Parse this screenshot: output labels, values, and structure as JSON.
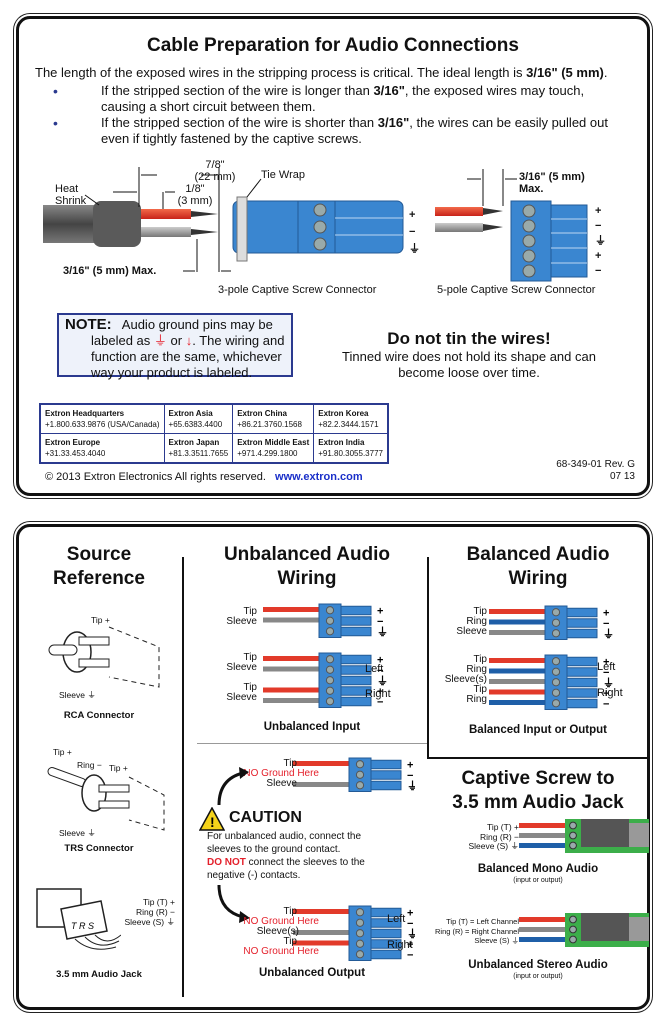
{
  "top_card": {
    "title": "Cable Preparation for Audio Connections",
    "intro_pre": "The length of the exposed wires in the stripping process is critical. The ideal length is ",
    "intro_bold": "3/16\" (5 mm)",
    "intro_post": ".",
    "bullets": [
      {
        "pre": "If the stripped section of the wire is longer than ",
        "bold": "3/16\"",
        "post": ", the exposed wires may touch, causing a short circuit between them."
      },
      {
        "pre": "If the stripped section of the wire is shorter than ",
        "bold": "3/16\"",
        "post": ", the wires can be easily pulled out even if tightly fastened by the captive screws."
      }
    ],
    "diagram3": {
      "dim_top_1": "7/8\"",
      "dim_top_2": "(22 mm)",
      "dim_mid_1": "1/8\"",
      "dim_mid_2": "(3 mm)",
      "heat_shrink_1": "Heat",
      "heat_shrink_2": "Shrink",
      "tie_wrap": "Tie Wrap",
      "max_label": "3/16\" (5 mm) Max.",
      "caption": "3-pole Captive Screw Connector",
      "pin_symbols": [
        "+",
        "−",
        "⏚"
      ]
    },
    "diagram5": {
      "max_label_1": "3/16\" (5 mm)",
      "max_label_2": "Max.",
      "caption": "5-pole Captive Screw Connector",
      "pin_symbols": [
        "+",
        "−",
        "⏚",
        "+",
        "−"
      ]
    },
    "note": {
      "label": "NOTE:",
      "line1": "Audio ground pins may be",
      "line2_pre": "labeled as ",
      "line2_sym1": "⏚",
      "line2_mid": " or ",
      "line2_sym2": "↓",
      "line2_post": ". The wiring and",
      "line3": "function are the same, whichever",
      "line4": "way your product is labeled."
    },
    "tin": {
      "title": "Do not tin the wires!",
      "line1": "Tinned wire does not hold its shape and can",
      "line2": "become loose over time."
    },
    "contacts": [
      [
        {
          "name": "Extron Headquarters",
          "phone": "+1.800.633.9876 (USA/Canada)"
        },
        {
          "name": "Extron Asia",
          "phone": "+65.6383.4400"
        },
        {
          "name": "Extron China",
          "phone": "+86.21.3760.1568"
        },
        {
          "name": "Extron Korea",
          "phone": "+82.2.3444.1571"
        }
      ],
      [
        {
          "name": "Extron Europe",
          "phone": "+31.33.453.4040"
        },
        {
          "name": "Extron Japan",
          "phone": "+81.3.3511.7655"
        },
        {
          "name": "Extron Middle East",
          "phone": "+971.4.299.1800"
        },
        {
          "name": "Extron India",
          "phone": "+91.80.3055.3777"
        }
      ]
    ],
    "doc_number": "68-349-01  Rev. G",
    "doc_date": "07 13",
    "copyright": "© 2013 Extron Electronics   All rights reserved.",
    "website": "www.extron.com"
  },
  "bottom_card": {
    "source_ref": {
      "title_1": "Source",
      "title_2": "Reference",
      "rca": {
        "tip": "Tip +",
        "sleeve": "Sleeve ⏚",
        "caption": "RCA Connector"
      },
      "trs": {
        "tip_left": "Tip +",
        "ring": "Ring −",
        "tip_right": "Tip +",
        "sleeve": "Sleeve ⏚",
        "caption": "TRS Connector"
      },
      "jack": {
        "tip": "Tip (T) +",
        "ring": "Ring (R) −",
        "sleeve": "Sleeve (S) ⏚",
        "letters": "T R S",
        "caption": "3.5 mm Audio Jack"
      }
    },
    "unbalanced": {
      "title_1": "Unbalanced Audio",
      "title_2": "Wiring",
      "input3": [
        "Tip",
        "Sleeve"
      ],
      "input5": [
        "Tip",
        "Sleeve",
        "Tip",
        "Sleeve"
      ],
      "left": "Left",
      "right": "Right",
      "input_caption": "Unbalanced Input",
      "out3": {
        "tip": "Tip",
        "no_ground": "NO Ground Here",
        "sleeve": "Sleeve"
      },
      "caution": {
        "title": "CAUTION",
        "line1": "For unbalanced audio, connect the",
        "line2": "sleeves to the ground contact.",
        "line3_red": "DO NOT",
        "line3_post": " connect the sleeves to the",
        "line4": "negative (-) contacts."
      },
      "out5": {
        "tip": "Tip",
        "no_ground": "NO Ground Here",
        "sleeves": "Sleeve(s)"
      },
      "output_caption": "Unbalanced Output"
    },
    "balanced": {
      "title_1": "Balanced Audio",
      "title_2": "Wiring",
      "three": [
        "Tip",
        "Ring",
        "Sleeve"
      ],
      "five": [
        "Tip",
        "Ring",
        "Sleeve(s)",
        "Tip",
        "Ring"
      ],
      "left": "Left",
      "right": "Right",
      "caption": "Balanced Input or Output"
    },
    "jack": {
      "title_1": "Captive Screw to",
      "title_2": "3.5 mm Audio Jack",
      "mono": {
        "tip": "Tip (T) +",
        "ring": "Ring (R) −",
        "sleeve": "Sleeve (S) ⏚",
        "caption": "Balanced Mono Audio",
        "sub": "(input or output)"
      },
      "stereo": {
        "tip": "Tip (T) = Left Channel",
        "ring": "Ring (R) = Right Channel",
        "sleeve": "Sleeve (S) ⏚",
        "caption": "Unbalanced Stereo Audio",
        "sub": "(input or output)"
      }
    }
  },
  "colors": {
    "connector_blue": "#3a86d0",
    "wire_red": "#e23a2a",
    "wire_blue": "#1f5fa8",
    "wire_gray": "#888888",
    "jack_green": "#3cae4a",
    "border_navy": "#2b3a8f",
    "link_blue": "#1a2fc9",
    "alert_red": "#e4202b"
  }
}
